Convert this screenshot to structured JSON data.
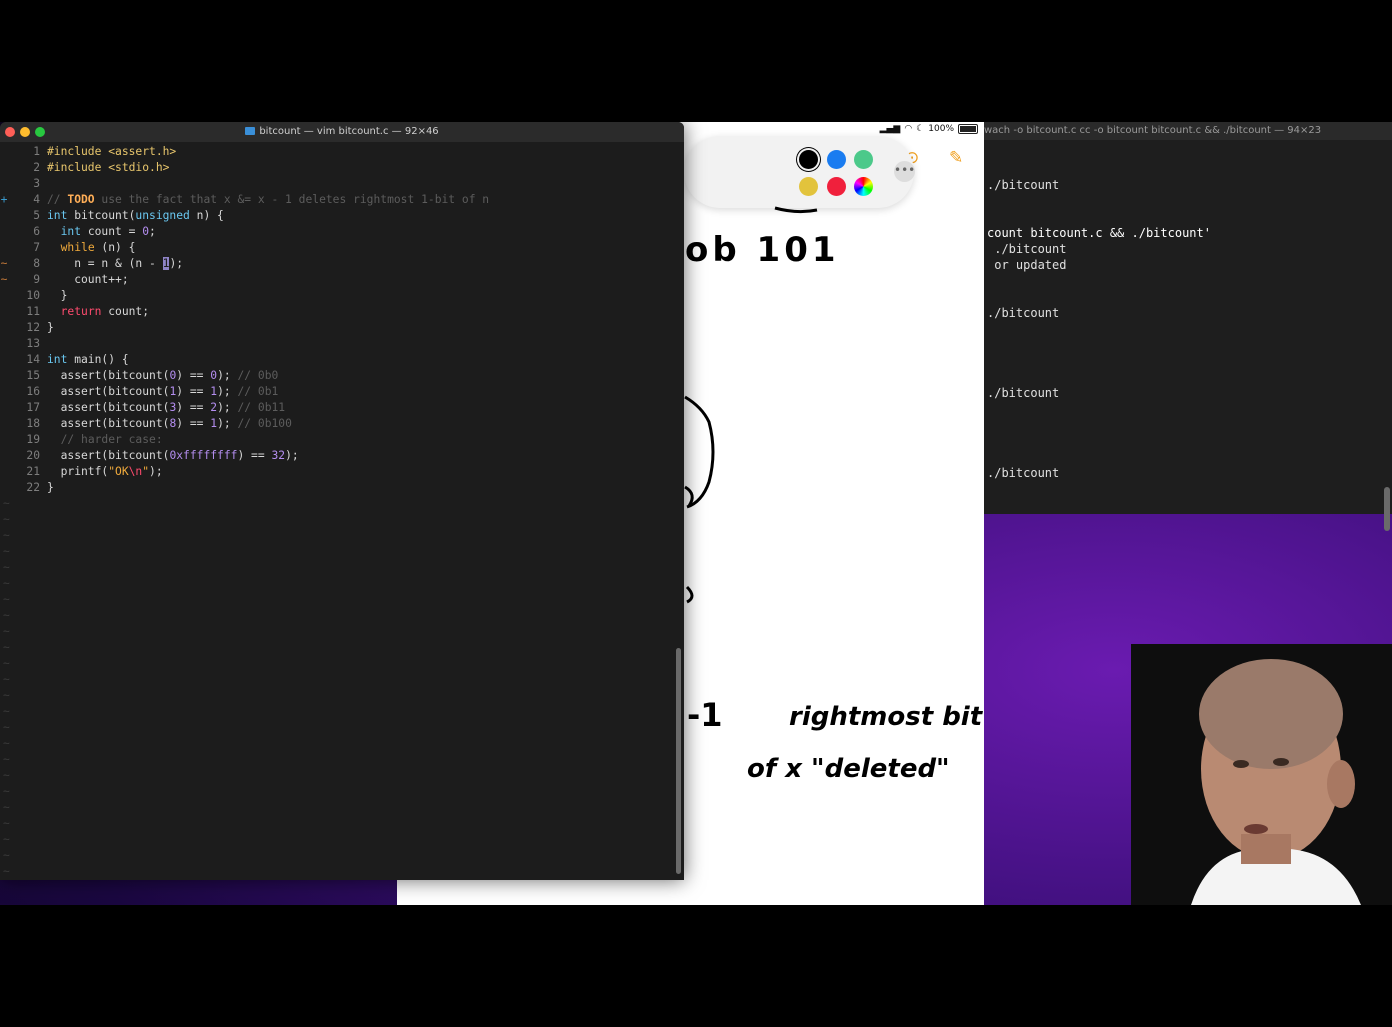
{
  "vim": {
    "title": "bitcount — vim bitcount.c — 92×46",
    "lines": [
      {
        "n": "1",
        "g": "",
        "t": "#include <assert.h>"
      },
      {
        "n": "2",
        "g": "",
        "t": "#include <stdio.h>"
      },
      {
        "n": "3",
        "g": "",
        "t": ""
      },
      {
        "n": "4",
        "g": "+",
        "t": "// TODO use the fact that x &= x - 1 deletes rightmost 1-bit of n"
      },
      {
        "n": "5",
        "g": "",
        "t": "int bitcount(unsigned n) {"
      },
      {
        "n": "6",
        "g": "",
        "t": "  int count = 0;"
      },
      {
        "n": "7",
        "g": "",
        "t": "  while (n) {"
      },
      {
        "n": "8",
        "g": "~",
        "t": "    n = n & (n - 1);"
      },
      {
        "n": "9",
        "g": "~",
        "t": "    count++;"
      },
      {
        "n": "10",
        "g": "",
        "t": "  }"
      },
      {
        "n": "11",
        "g": "",
        "t": "  return count;"
      },
      {
        "n": "12",
        "g": "",
        "t": "}"
      },
      {
        "n": "13",
        "g": "",
        "t": ""
      },
      {
        "n": "14",
        "g": "",
        "t": "int main() {"
      },
      {
        "n": "15",
        "g": "",
        "t": "  assert(bitcount(0) == 0); // 0b0"
      },
      {
        "n": "16",
        "g": "",
        "t": "  assert(bitcount(1) == 1); // 0b1"
      },
      {
        "n": "17",
        "g": "",
        "t": "  assert(bitcount(3) == 2); // 0b11"
      },
      {
        "n": "18",
        "g": "",
        "t": "  assert(bitcount(8) == 1); // 0b100"
      },
      {
        "n": "19",
        "g": "",
        "t": "  // harder case:"
      },
      {
        "n": "20",
        "g": "",
        "t": "  assert(bitcount(0xffffffff) == 32);"
      },
      {
        "n": "21",
        "g": "",
        "t": "  printf(\"OK\\n\");"
      },
      {
        "n": "22",
        "g": "",
        "t": "}"
      }
    ],
    "empty_marker": "~"
  },
  "terminal": {
    "title": "wach -o bitcount.c cc -o bitcount bitcount.c && ./bitcount — 94×23",
    "lines": [
      "./bitcount",
      "count bitcount.c && ./bitcount'",
      " ./bitcount",
      " or updated",
      "./bitcount",
      "./bitcount",
      "./bitcount"
    ]
  },
  "ipad": {
    "battery": "100%",
    "handwriting": [
      "ob 101",
      "-1",
      "rightmost bit",
      "of x \"deleted\""
    ],
    "palette_colors": [
      "#000000",
      "#1a7cf0",
      "#4cc98a",
      "#e2c33c",
      "#f0203c"
    ]
  },
  "colors": {
    "close": "#ff5f57",
    "minimize": "#febc2e",
    "zoom": "#28c840"
  }
}
